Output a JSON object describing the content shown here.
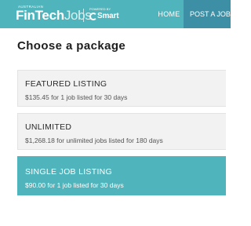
{
  "header": {
    "logo": {
      "tagline": "AUSTRALIAN",
      "brand_main": "FinTech",
      "brand_jobs": "Jobs",
      "partner_tagline": "POWERED BY",
      "partner_name": "Smart"
    },
    "nav": [
      {
        "label": "HOME"
      },
      {
        "label": "POST A JOB"
      }
    ],
    "colors": {
      "bar": "#4fb4bb",
      "active_nav": "#3c8fa5"
    }
  },
  "main": {
    "title": "Choose a package",
    "packages": [
      {
        "name": "FEATURED LISTING",
        "description": "$135.45 for 1 job listed for 30 days",
        "selected": false
      },
      {
        "name": "UNLIMITED",
        "description": "$1,268.18 for unlimited jobs listed for 180 days",
        "selected": false
      },
      {
        "name": "SINGLE JOB LISTING",
        "description": "$90.00 for 1 job listed for 30 days",
        "selected": true
      }
    ],
    "colors": {
      "card_bg": "#f2f2f2",
      "selected_bg": "#4fb4bb"
    }
  }
}
